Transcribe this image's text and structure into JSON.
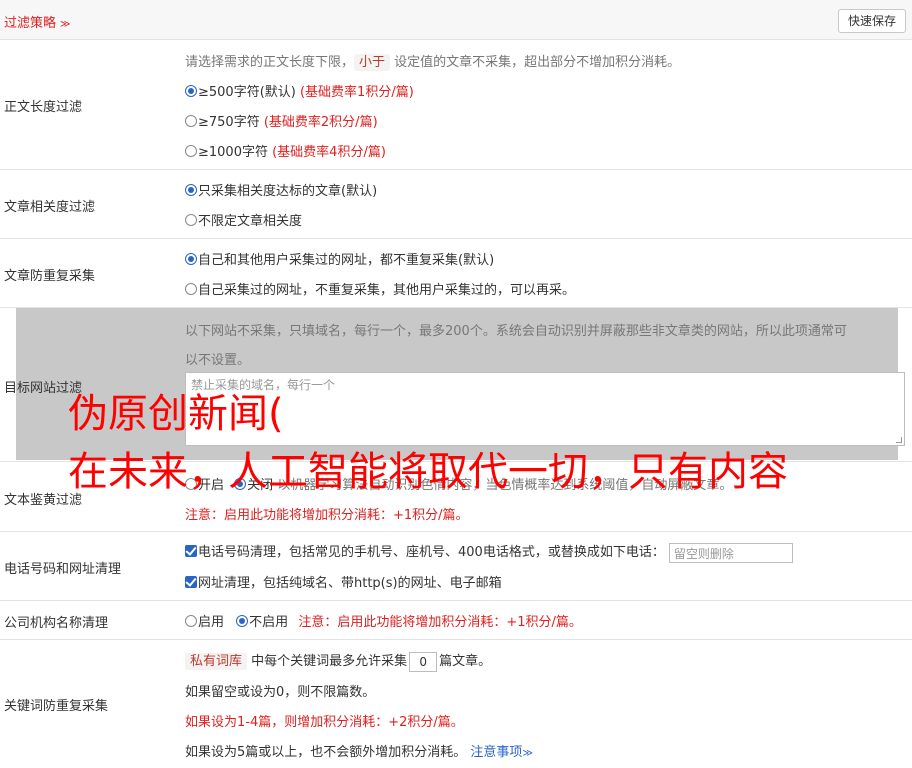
{
  "header": {
    "title": "过滤策略",
    "chev": "≫",
    "save_label": "快速保存"
  },
  "length_filter": {
    "label": "正文长度过滤",
    "desc_a": "请选择需求的正文长度下限，",
    "desc_pill": "小于",
    "desc_b": " 设定值的文章不采集，超出部分不增加积分消耗。",
    "opt1": "≥500字符(默认) ",
    "opt1_note": "(基础费率1积分/篇)",
    "opt2": "≥750字符 ",
    "opt2_note": "(基础费率2积分/篇)",
    "opt3": "≥1000字符 ",
    "opt3_note": "(基础费率4积分/篇)"
  },
  "relevance": {
    "label": "文章相关度过滤",
    "opt1": "只采集相关度达标的文章(默认)",
    "opt2": "不限定文章相关度"
  },
  "dedup": {
    "label": "文章防重复采集",
    "opt1": "自己和其他用户采集过的网址，都不重复采集(默认)",
    "opt2": "自己采集过的网址，不重复采集，其他用户采集过的，可以再采。"
  },
  "site_filter": {
    "label": "目标网站过滤",
    "desc1": "以下网站不采集，只填域名，每行一个，最多200个。系统会自动识别并屏蔽那些非文章类的网站，所以此项通常可",
    "desc2": "以不设置。",
    "placeholder": "禁止采集的域名，每行一个"
  },
  "porn_filter": {
    "label": "文本鉴黄过滤",
    "opt_on": "开启",
    "opt_off": "关闭",
    "desc": "以机器学习算法自动识别色情内容，当色情概率达到系统阈值，自动屏蔽文章。",
    "note": "注意：启用此功能将增加积分消耗：+1积分/篇。"
  },
  "phone_filter": {
    "label": "电话号码和网址清理",
    "opt1": "电话号码清理，包括常见的手机号、座机号、400电话格式，或替换成如下电话：",
    "phone_placeholder": "留空则删除",
    "opt2": "网址清理，包括纯域名、带http(s)的网址、电子邮箱"
  },
  "org_filter": {
    "label": "公司机构名称清理",
    "opt_on": "启用",
    "opt_off": "不启用",
    "note": "注意：启用此功能将增加积分消耗：+1积分/篇。"
  },
  "keyword_dedup": {
    "label": "关键词防重复采集",
    "pill": "私有词库",
    "line1_a": " 中每个关键词最多允许采集",
    "count": "0",
    "line1_b": "篇文章。",
    "line2": "如果留空或设为0，则不限篇数。",
    "line3": "如果设为1-4篇，则增加积分消耗：+2积分/篇。",
    "line4": "如果设为5篇或以上，也不会额外增加积分消耗。",
    "link": "注意事项",
    "link_chev": "≫"
  },
  "overlay": {
    "line1": "伪原创新闻(",
    "line2": "在未来，人工智能将取代一切，只有内容"
  }
}
